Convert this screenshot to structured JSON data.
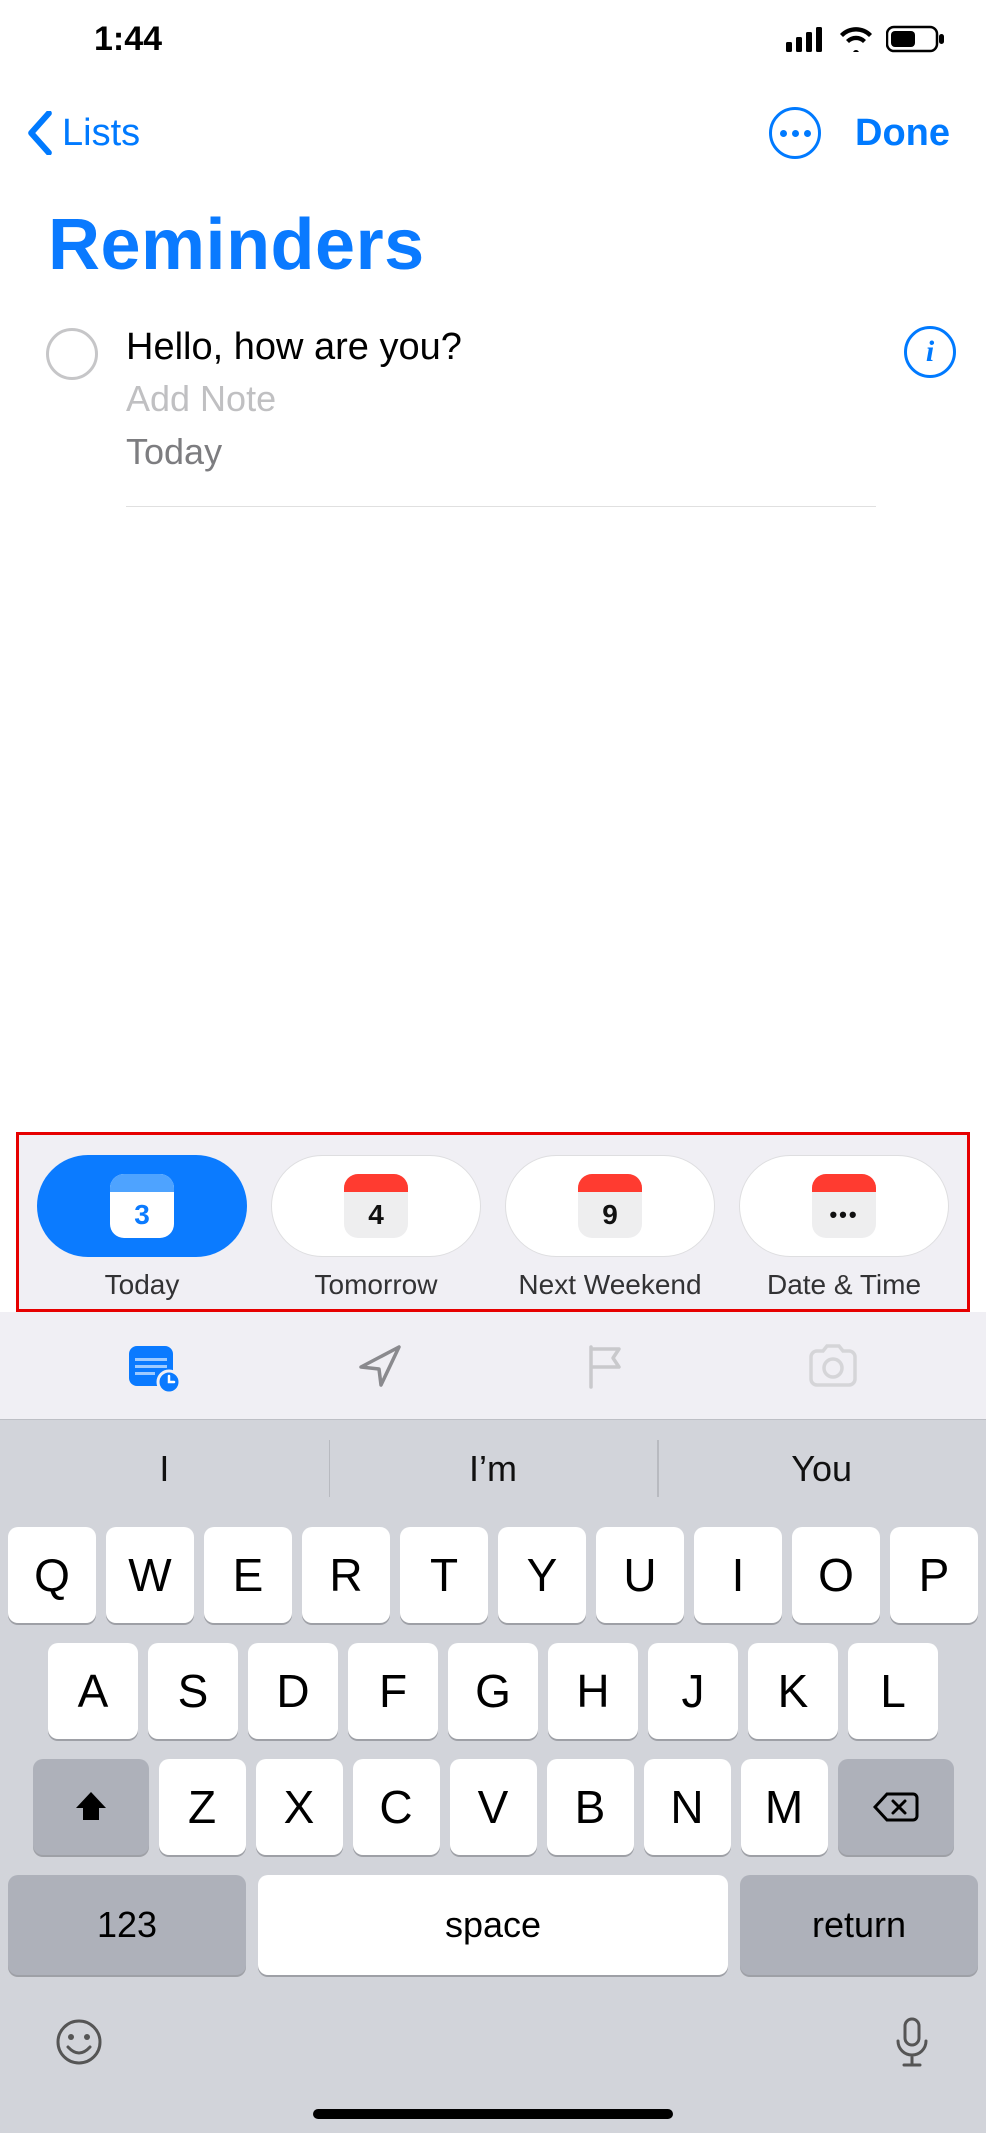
{
  "status": {
    "time": "1:44"
  },
  "nav": {
    "back_label": "Lists",
    "done_label": "Done"
  },
  "page": {
    "title": "Reminders"
  },
  "reminder": {
    "title": "Hello, how are you?",
    "note_placeholder": "Add Note",
    "date_text": "Today"
  },
  "date_chips": [
    {
      "day": "3",
      "label": "Today",
      "selected": true
    },
    {
      "day": "4",
      "label": "Tomorrow",
      "selected": false
    },
    {
      "day": "9",
      "label": "Next Weekend",
      "selected": false
    },
    {
      "day": "•••",
      "label": "Date & Time",
      "selected": false,
      "dots": true
    }
  ],
  "predictive": [
    "I",
    "I’m",
    "You"
  ],
  "keyboard": {
    "row1": [
      "Q",
      "W",
      "E",
      "R",
      "T",
      "Y",
      "U",
      "I",
      "O",
      "P"
    ],
    "row2": [
      "A",
      "S",
      "D",
      "F",
      "G",
      "H",
      "J",
      "K",
      "L"
    ],
    "row3": [
      "Z",
      "X",
      "C",
      "V",
      "B",
      "N",
      "M"
    ],
    "abc_label": "123",
    "space_label": "space",
    "return_label": "return"
  }
}
